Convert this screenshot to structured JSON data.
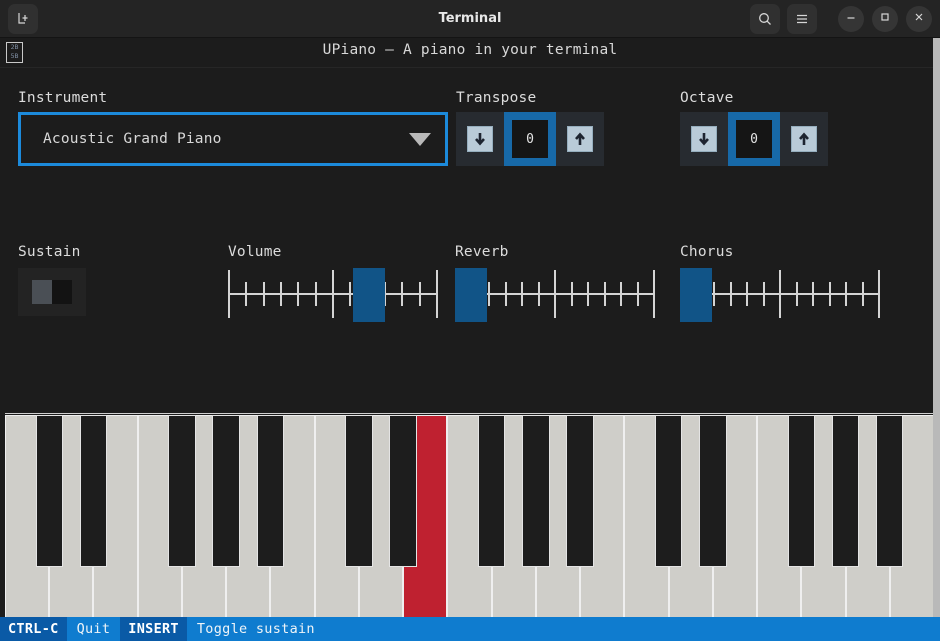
{
  "window": {
    "title": "Terminal",
    "new_tab_icon": "new-tab-icon",
    "search_icon": "search-icon",
    "menu_icon": "hamburger-menu-icon",
    "minimize_icon": "minimize-icon",
    "maximize_icon": "maximize-icon",
    "close_icon": "close-icon"
  },
  "app": {
    "glyph_code_top": "2B",
    "glyph_code_bottom": "5B",
    "title": "UPiano — A piano in your terminal"
  },
  "instrument": {
    "label": "Instrument",
    "value": "Acoustic Grand Piano",
    "caret_icon": "chevron-down-icon",
    "focus_color": "#1c8adb"
  },
  "transpose": {
    "label": "Transpose",
    "value": "0",
    "down_icon": "arrow-down-icon",
    "up_icon": "arrow-up-icon",
    "focus_color": "#1769a8"
  },
  "octave": {
    "label": "Octave",
    "value": "0",
    "down_icon": "arrow-down-icon",
    "up_icon": "arrow-up-icon",
    "focus_color": "#1769a8"
  },
  "sustain": {
    "label": "Sustain",
    "state": "off"
  },
  "sliders": [
    {
      "label": "Volume",
      "value": 70,
      "handle_color": "#115487"
    },
    {
      "label": "Reverb",
      "value": 0,
      "handle_color": "#115487"
    },
    {
      "label": "Chorus",
      "value": 0,
      "handle_color": "#115487"
    }
  ],
  "piano": {
    "white_key_count": 21,
    "pressed_white_key_index": 9,
    "white_key_color": "#cfcec9",
    "black_key_color": "#1d1d1d",
    "pressed_color": "#bf2130",
    "black_key_pattern": [
      0,
      1,
      3,
      4,
      5
    ],
    "octaves": 3
  },
  "statusbar": {
    "items": [
      {
        "key": "CTRL-C",
        "desc": "Quit"
      },
      {
        "key": "INSERT",
        "desc": "Toggle sustain"
      }
    ],
    "key_bg": "#0a5aa6",
    "desc_bg": "#0f7ccf"
  }
}
